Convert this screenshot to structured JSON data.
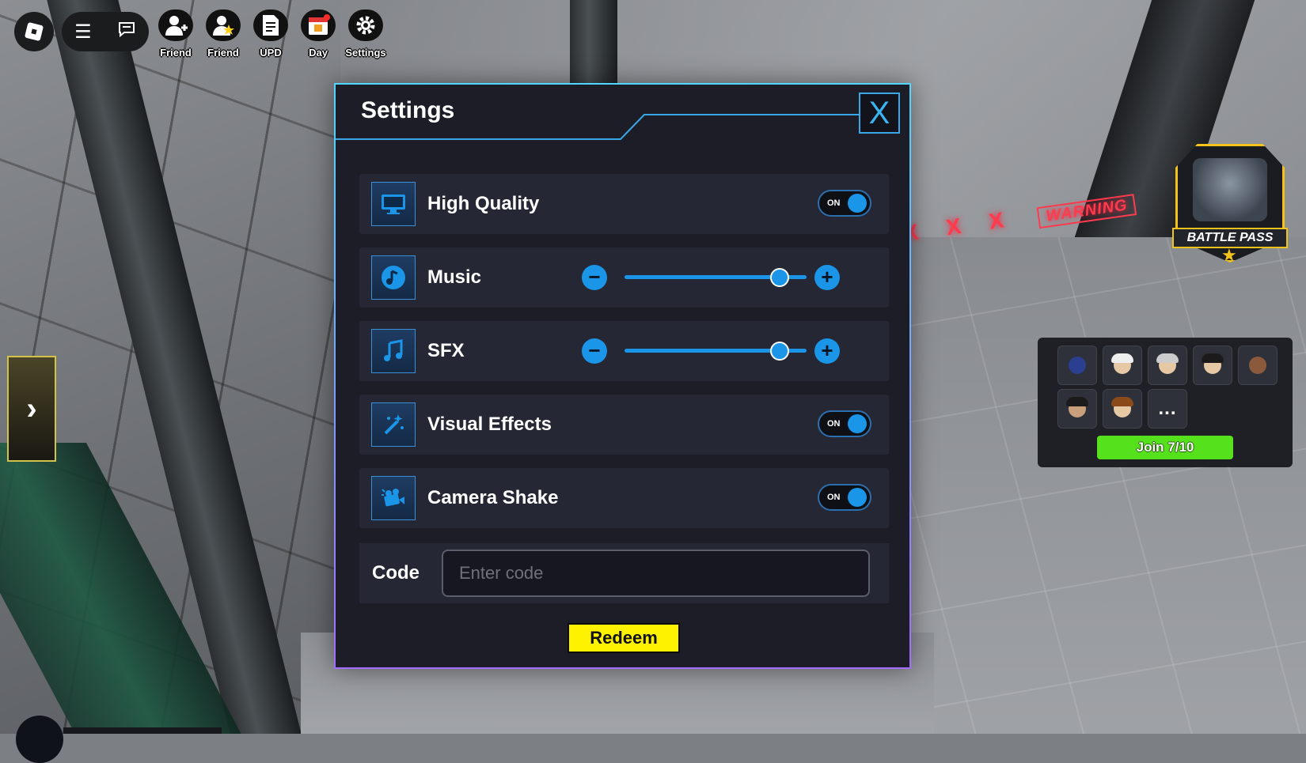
{
  "hud": {
    "buttons": [
      {
        "label": "Friend",
        "icon": "add-friend-icon"
      },
      {
        "label": "Friend",
        "icon": "friend-star-icon"
      },
      {
        "label": "UPD",
        "icon": "update-notes-icon"
      },
      {
        "label": "Day",
        "icon": "daily-calendar-icon"
      },
      {
        "label": "Settings",
        "icon": "gear-icon"
      }
    ]
  },
  "world": {
    "warning_marks": "X X X",
    "warning_sign": "WARNING"
  },
  "settings": {
    "title": "Settings",
    "close_label": "X",
    "rows": {
      "high_quality": {
        "label": "High Quality",
        "toggle": "ON",
        "on": true
      },
      "music": {
        "label": "Music",
        "level": 0.85
      },
      "sfx": {
        "label": "SFX",
        "level": 0.85
      },
      "visual_effects": {
        "label": "Visual Effects",
        "toggle": "ON",
        "on": true
      },
      "camera_shake": {
        "label": "Camera Shake",
        "toggle": "ON",
        "on": true
      }
    },
    "code": {
      "label": "Code",
      "placeholder": "Enter code",
      "value": ""
    },
    "redeem_label": "Redeem"
  },
  "battle_pass": {
    "label": "BATTLE PASS"
  },
  "server": {
    "more_label": "...",
    "join_label": "Join 7/10"
  },
  "colors": {
    "accent": "#1b95e8",
    "panel_bg": "#1c1d26",
    "row_bg": "#252734",
    "redeem": "#fff200",
    "join": "#55e11b",
    "battle_pass_gold": "#f3c21b"
  }
}
